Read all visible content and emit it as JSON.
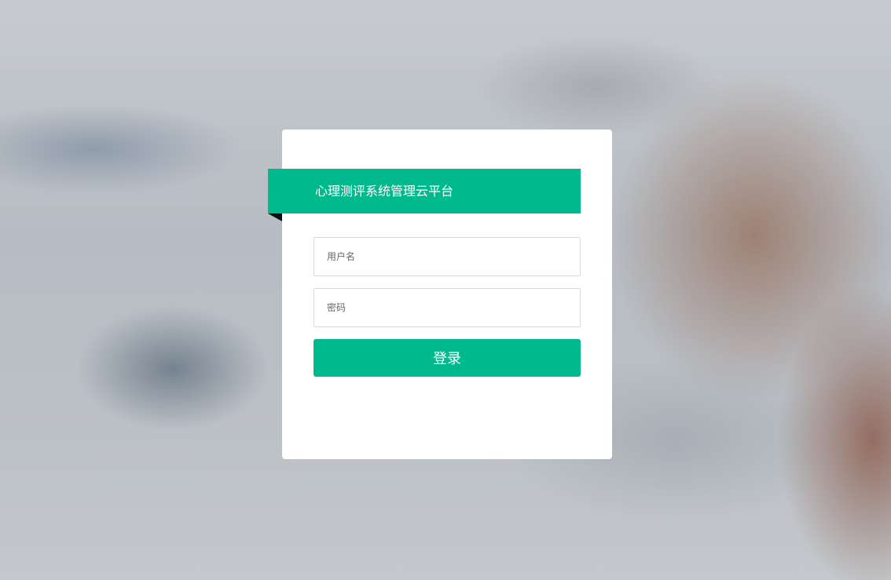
{
  "login": {
    "title": "心理测评系统管理云平台",
    "username": {
      "placeholder": "用户名",
      "value": ""
    },
    "password": {
      "placeholder": "密码",
      "value": ""
    },
    "submit_label": "登录"
  },
  "colors": {
    "accent": "#00b98d",
    "card": "#ffffff"
  }
}
